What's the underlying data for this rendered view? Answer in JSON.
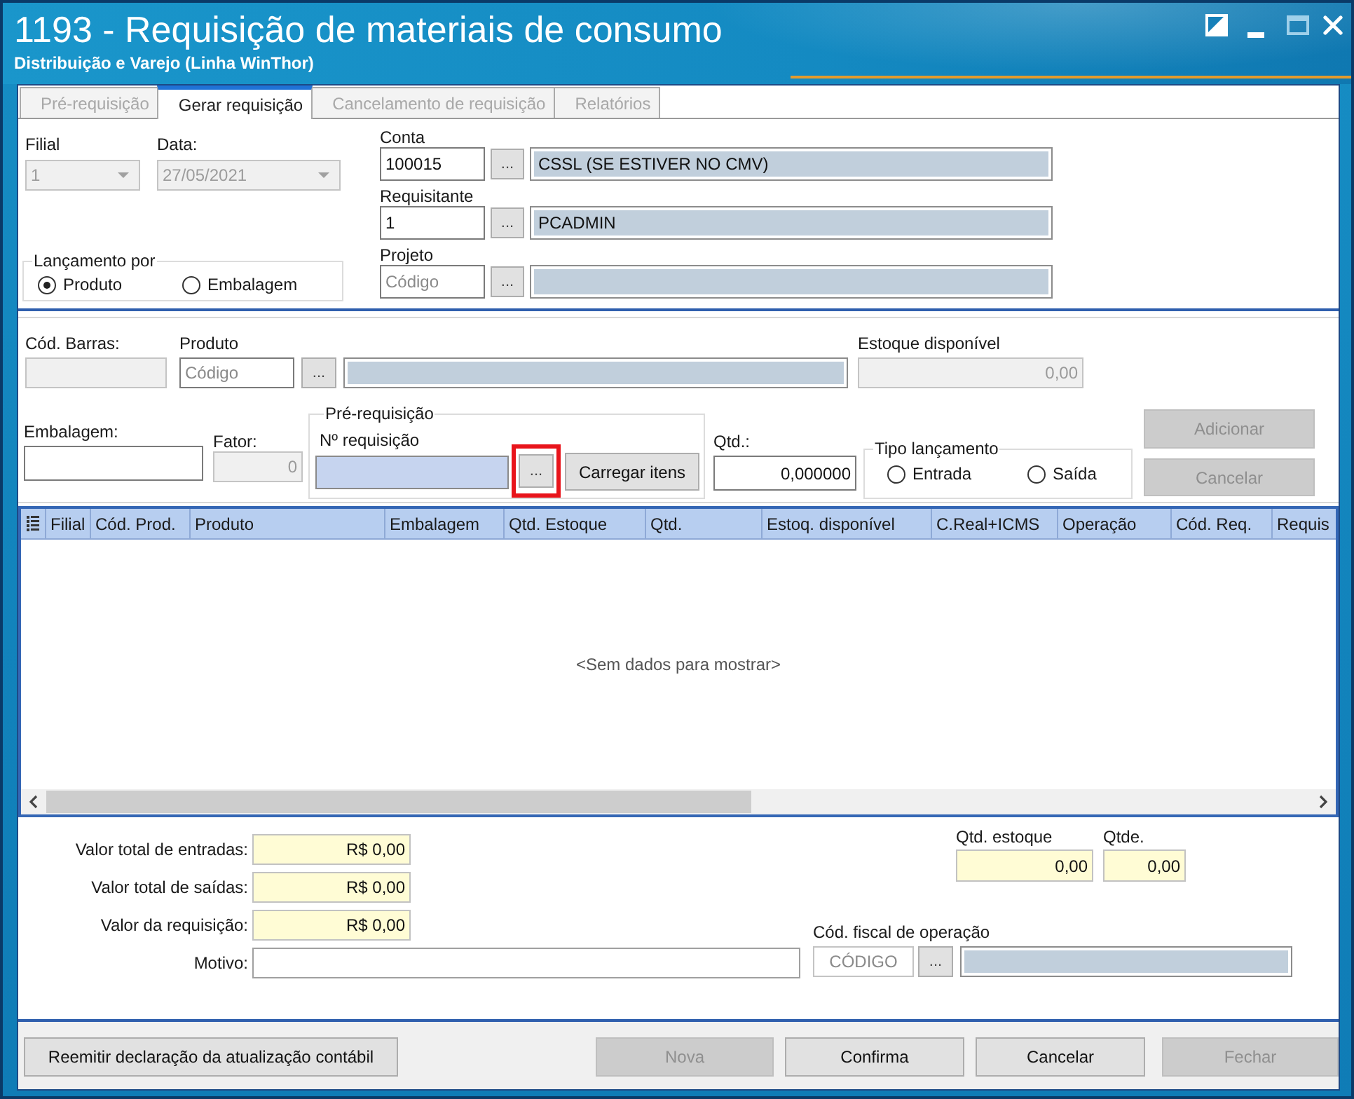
{
  "window": {
    "title": "1193 - Requisição de materiais de consumo",
    "subtitle": "Distribuição e Varejo (Linha WinThor)"
  },
  "tabs": [
    {
      "label": "Pré-requisição",
      "selected": false,
      "disabled": true
    },
    {
      "label": "Gerar requisição",
      "selected": true,
      "disabled": false
    },
    {
      "label": "Cancelamento de requisição",
      "selected": false,
      "disabled": true
    },
    {
      "label": "Relatórios",
      "selected": false,
      "disabled": true
    }
  ],
  "header": {
    "filial": {
      "label": "Filial",
      "value": "1",
      "disabled": true
    },
    "data": {
      "label": "Data:",
      "value": "27/05/2021",
      "disabled": true
    },
    "lancamento_por": {
      "title": "Lançamento por",
      "options": [
        {
          "label": "Produto",
          "selected": true
        },
        {
          "label": "Embalagem",
          "selected": false
        }
      ]
    },
    "lookups": [
      {
        "label": "Conta",
        "code": "100015",
        "button": "...",
        "description": "CSSL (SE ESTIVER NO CMV)"
      },
      {
        "label": "Requisitante",
        "code": "1",
        "button": "...",
        "description": "PCADMIN"
      },
      {
        "label": "Projeto",
        "placeholder": "Código",
        "button": "..."
      }
    ]
  },
  "product": {
    "cod_barras": {
      "label": "Cód. Barras:",
      "disabled": true
    },
    "produto": {
      "label": "Produto",
      "placeholder": "Código",
      "button": "..."
    },
    "estoque_disponivel": {
      "label": "Estoque disponível",
      "value": "0,00",
      "disabled": true
    },
    "embalagem": {
      "label": "Embalagem:"
    },
    "fator": {
      "label": "Fator:",
      "value": "0",
      "disabled": true
    },
    "pre_requisicao": {
      "title": "Pré-requisição",
      "label": "Nº requisição",
      "button": "...",
      "highlighted": true,
      "load_button": "Carregar itens"
    },
    "qtd": {
      "label": "Qtd.:",
      "value": "0,000000"
    },
    "tipo_lancamento": {
      "title": "Tipo lançamento",
      "options": [
        {
          "label": "Entrada",
          "selected": false
        },
        {
          "label": "Saída",
          "selected": false
        }
      ]
    },
    "actions": [
      {
        "label": "Adicionar",
        "disabled": true
      },
      {
        "label": "Cancelar",
        "disabled": true
      }
    ]
  },
  "grid": {
    "columns": [
      "Filial",
      "Cód. Prod.",
      "Produto",
      "Embalagem",
      "Qtd. Estoque",
      "Qtd.",
      "Estoq. disponível",
      "C.Real+ICMS",
      "Operação",
      "Cód. Req.",
      "Requis"
    ],
    "empty_text": "<Sem dados para mostrar>"
  },
  "totals": {
    "values": [
      {
        "label": "Valor total de entradas:",
        "value": "R$ 0,00"
      },
      {
        "label": "Valor total de saídas:",
        "value": "R$ 0,00"
      },
      {
        "label": "Valor da requisição:",
        "value": "R$ 0,00"
      }
    ],
    "motivo": {
      "label": "Motivo:"
    },
    "quantities": [
      {
        "label": "Qtd. estoque",
        "value": "0,00"
      },
      {
        "label": "Qtde.",
        "value": "0,00"
      }
    ],
    "cfop": {
      "label": "Cód. fiscal de operação",
      "placeholder": "CÓDIGO",
      "button": "..."
    }
  },
  "footer": {
    "reissue_button": "Reemitir declaração da atualização contábil",
    "buttons": [
      {
        "label": "Nova",
        "disabled": true
      },
      {
        "label": "Confirma",
        "disabled": false
      },
      {
        "label": "Cancelar",
        "disabled": false
      },
      {
        "label": "Fechar",
        "disabled": true
      }
    ]
  }
}
